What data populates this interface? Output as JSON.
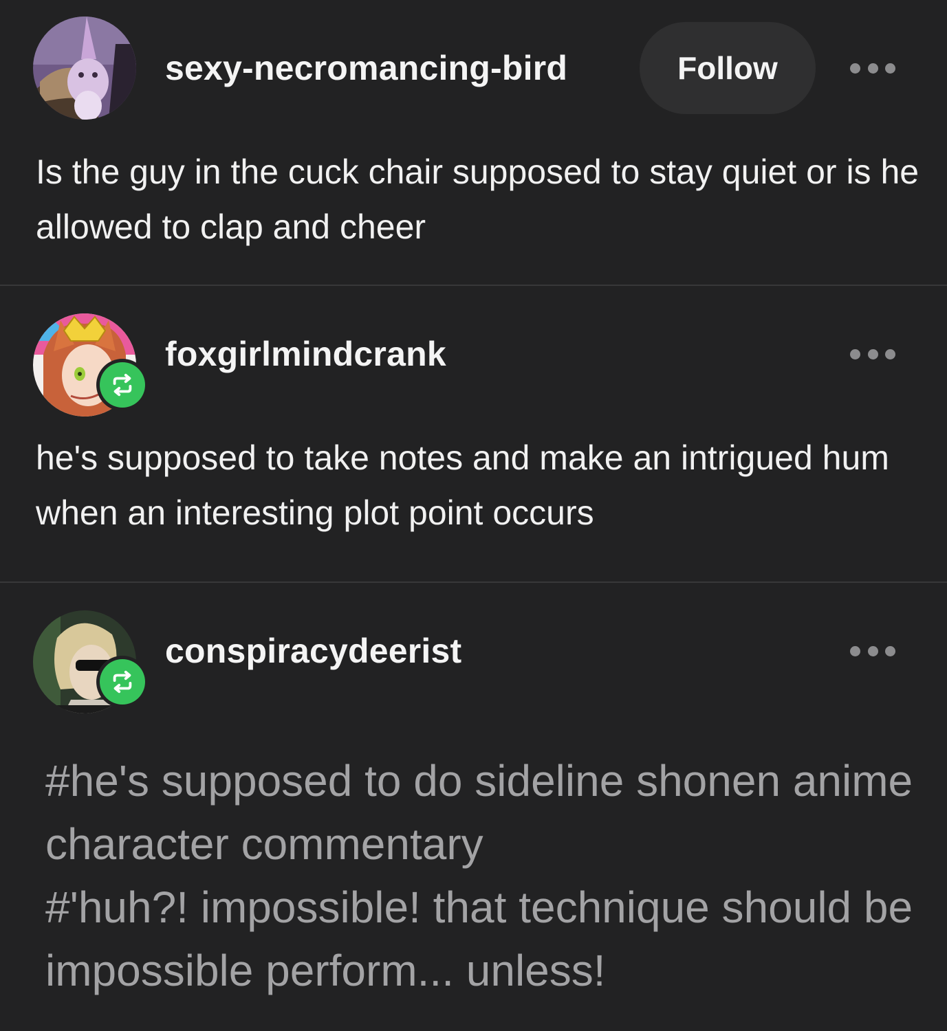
{
  "posts": [
    {
      "username": "sexy-necromancing-bird",
      "follow_label": "Follow",
      "avatar": "pink-cat-avatar",
      "more_icon": "more-options-icon",
      "body": "Is the guy in the cuck chair supposed to stay quiet or is he allowed to clap and cheer"
    },
    {
      "username": "foxgirlmindcrank",
      "avatar": "anime-fox-girl-avatar",
      "badge_icon": "reblog-icon",
      "more_icon": "more-options-icon",
      "body": "he's supposed to take notes and make an intrigued hum when an interesting plot point occurs"
    },
    {
      "username": "conspiracydeerist",
      "avatar": "anime-sunglasses-avatar",
      "badge_icon": "reblog-icon",
      "more_icon": "more-options-icon",
      "tags": [
        "#he's supposed to do sideline shonen anime character commentary",
        "#'huh?! impossible! that technique should be impossible perform... unless!"
      ]
    }
  ],
  "colors": {
    "background": "#222223",
    "divider": "#383839",
    "reblog_badge": "#36c45b",
    "tag_text": "#a3a3a5"
  }
}
